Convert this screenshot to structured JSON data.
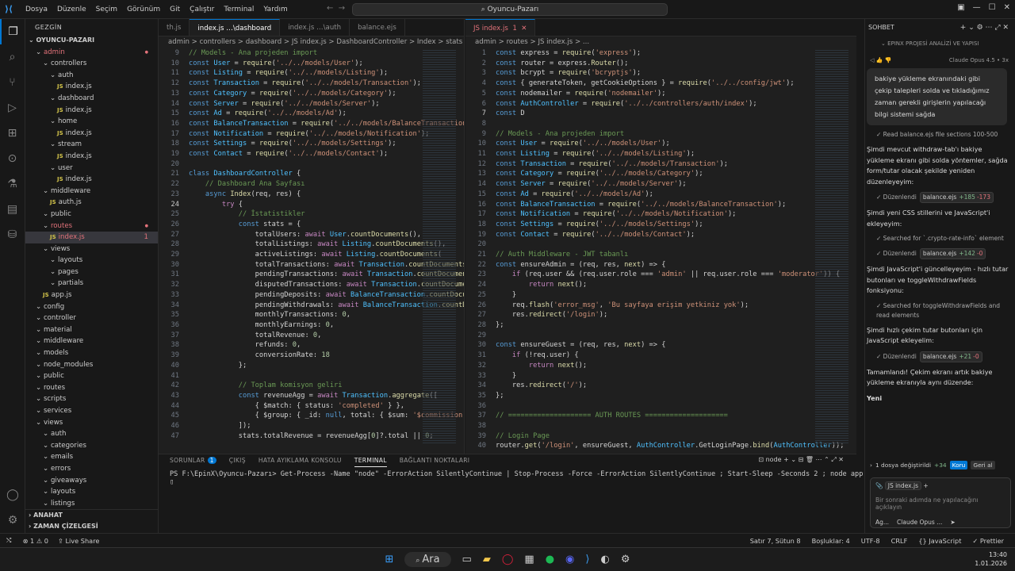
{
  "menu": [
    "Dosya",
    "Düzenle",
    "Seçim",
    "Görünüm",
    "Git",
    "Çalıştır",
    "Terminal",
    "Yardım"
  ],
  "search": "Oyuncu-Pazarı",
  "sidebar": {
    "title": "GEZGİN",
    "root": "OYUNCU-PAZARI",
    "tree": [
      {
        "t": "admin",
        "d": 1,
        "f": 1,
        "m": 1
      },
      {
        "t": "controllers",
        "d": 2,
        "f": 1
      },
      {
        "t": "auth",
        "d": 3,
        "f": 1
      },
      {
        "t": "index.js",
        "d": 4,
        "js": 1
      },
      {
        "t": "dashboard",
        "d": 3,
        "f": 1
      },
      {
        "t": "index.js",
        "d": 4,
        "js": 1
      },
      {
        "t": "home",
        "d": 3,
        "f": 1
      },
      {
        "t": "index.js",
        "d": 4,
        "js": 1
      },
      {
        "t": "stream",
        "d": 3,
        "f": 1
      },
      {
        "t": "index.js",
        "d": 4,
        "js": 1
      },
      {
        "t": "user",
        "d": 3,
        "f": 1
      },
      {
        "t": "index.js",
        "d": 4,
        "js": 1
      },
      {
        "t": "middleware",
        "d": 2,
        "f": 1
      },
      {
        "t": "auth.js",
        "d": 3,
        "js": 1
      },
      {
        "t": "public",
        "d": 2,
        "f": 1
      },
      {
        "t": "routes",
        "d": 2,
        "f": 1,
        "m": 1
      },
      {
        "t": "index.js",
        "d": 3,
        "js": 1,
        "m": 1,
        "sel": 1,
        "badge": "1"
      },
      {
        "t": "views",
        "d": 2,
        "f": 1
      },
      {
        "t": "layouts",
        "d": 3,
        "f": 1
      },
      {
        "t": "pages",
        "d": 3,
        "f": 1
      },
      {
        "t": "partials",
        "d": 3,
        "f": 1
      },
      {
        "t": "app.js",
        "d": 2,
        "js": 1
      },
      {
        "t": "config",
        "d": 1,
        "f": 1
      },
      {
        "t": "controller",
        "d": 1,
        "f": 1
      },
      {
        "t": "material",
        "d": 1,
        "f": 1
      },
      {
        "t": "middleware",
        "d": 1,
        "f": 1
      },
      {
        "t": "models",
        "d": 1,
        "f": 1
      },
      {
        "t": "node_modules",
        "d": 1,
        "f": 1
      },
      {
        "t": "public",
        "d": 1,
        "f": 1
      },
      {
        "t": "routes",
        "d": 1,
        "f": 1
      },
      {
        "t": "scripts",
        "d": 1,
        "f": 1
      },
      {
        "t": "services",
        "d": 1,
        "f": 1
      },
      {
        "t": "views",
        "d": 1,
        "f": 1
      },
      {
        "t": "auth",
        "d": 2,
        "f": 1
      },
      {
        "t": "categories",
        "d": 2,
        "f": 1
      },
      {
        "t": "emails",
        "d": 2,
        "f": 1
      },
      {
        "t": "errors",
        "d": 2,
        "f": 1
      },
      {
        "t": "giveaways",
        "d": 2,
        "f": 1
      },
      {
        "t": "layouts",
        "d": 2,
        "f": 1
      },
      {
        "t": "listings",
        "d": 2,
        "f": 1
      }
    ],
    "outline": "ANAHAT",
    "timeline": "ZAMAN ÇİZELGESİ"
  },
  "editor1": {
    "tabs": [
      "th.js",
      "index.js …\\dashboard",
      "index.js …\\auth",
      "balance.ejs"
    ],
    "breadcrumb": "admin > controllers > dashboard > JS index.js > DashboardController > Index > stats",
    "lines": [
      "// Models - Ana projeden import",
      "const User = require('../../models/User');",
      "const Listing = require('../../models/Listing');",
      "const Transaction = require('../../models/Transaction');",
      "const Category = require('../../models/Category');",
      "const Server = require('../../models/Server');",
      "const Ad = require('../../models/Ad');",
      "const BalanceTransaction = require('../../models/BalanceTransaction');",
      "const Notification = require('../../models/Notification');",
      "const Settings = require('../../models/Settings');",
      "const Contact = require('../../models/Contact');",
      "",
      "class DashboardController {",
      "    // Dashboard Ana Sayfası",
      "    async Index(req, res) {",
      "        try {",
      "            // İstatistikler",
      "            const stats = {",
      "                totalUsers: await User.countDocuments(),",
      "                totalListings: await Listing.countDocuments(),",
      "                activeListings: await Listing.countDocuments(",
      "                totalTransactions: await Transaction.countDocuments(",
      "                pendingTransactions: await Transaction.countDocuments(",
      "                disputedTransactions: await Transaction.countDocuments(",
      "                pendingDeposits: await BalanceTransaction.countDocuments(",
      "                pendingWithdrawals: await BalanceTransaction.countDocuments(",
      "                monthlyTransactions: 0,",
      "                monthlyEarnings: 0,",
      "                totalRevenue: 0,",
      "                refunds: 0,",
      "                conversionRate: 18",
      "            };",
      "",
      "            // Toplam komisyon geliri",
      "            const revenueAgg = await Transaction.aggregate([",
      "                { $match: { status: 'completed' } },",
      "                { $group: { _id: null, total: { $sum: '$commission' } } }",
      "            ]);",
      "            stats.totalRevenue = revenueAgg[0]?.total || 0;"
    ],
    "start": 9,
    "cur": 24
  },
  "editor2": {
    "tab": "index.js",
    "tabBadge": "1",
    "breadcrumb": "admin > routes > JS index.js > ...",
    "lines": [
      "const express = require('express');",
      "const router = express.Router();",
      "const bcrypt = require('bcryptjs');",
      "const { generateToken, getCookieOptions } = require('../../config/jwt');",
      "const nodemailer = require('nodemailer');",
      "const AuthController = require('../../controllers/auth/index');",
      "const D",
      "",
      "// Models - Ana projeden import",
      "const User = require('../../models/User');",
      "const Listing = require('../../models/Listing');",
      "const Transaction = require('../../models/Transaction');",
      "const Category = require('../../models/Category');",
      "const Server = require('../../models/Server');",
      "const Ad = require('../../models/Ad');",
      "const BalanceTransaction = require('../../models/BalanceTransaction');",
      "const Notification = require('../../models/Notification');",
      "const Settings = require('../../models/Settings');",
      "const Contact = require('../../models/Contact');",
      "",
      "// Auth Middleware - JWT tabanlı",
      "const ensureAdmin = (req, res, next) => {",
      "    if (req.user && (req.user.role === 'admin' || req.user.role === 'moderator')) {",
      "        return next();",
      "    }",
      "    req.flash('error_msg', 'Bu sayfaya erişim yetkiniz yok');",
      "    res.redirect('/login');",
      "};",
      "",
      "const ensureGuest = (req, res, next) => {",
      "    if (!req.user) {",
      "        return next();",
      "    }",
      "    res.redirect('/');",
      "};",
      "",
      "// ==================== AUTH ROUTES ====================",
      "",
      "// Login Page",
      "router.get('/login', ensureGuest, AuthController.GetLoginPage.bind(AuthController));"
    ],
    "start": 1,
    "cur": 7
  },
  "panel": {
    "tabs": [
      "SORUNLAR",
      "ÇIKIŞ",
      "HATA AYIKLAMA KONSOLU",
      "TERMINAL",
      "BAĞLANTI NOKTALARI"
    ],
    "problems": "1",
    "shell": "node",
    "cmd": "PS F:\\EpinX\\Oyuncu-Pazarı> Get-Process -Name \"node\" -ErrorAction SilentlyContinue | Stop-Process -Force -ErrorAction SilentlyContinue ; Start-Sleep -Seconds 2 ; node app.js"
  },
  "chat": {
    "title": "SOHBET",
    "session": "EPINX PROJESİ ANALİZİ VE YAPISI",
    "model": "Claude Opus 4.5 • 3x",
    "user_msg": "bakiye yükleme ekranındaki gibi çekip talepleri solda ve tıkladığımız zaman gerekli girişlerin yapılacağı bilgi sistemi sağda",
    "items": [
      {
        "k": "s",
        "t": "Read balance.ejs file sections 100-500"
      },
      {
        "k": "p",
        "t": "Şimdi mevcut withdraw-tab'ı bakiye yükleme ekranı gibi solda yöntemler, sağda form/tutar olacak şekilde yeniden düzenleyeyim:"
      },
      {
        "k": "e",
        "t": "Düzenlendi",
        "f": "balance.ejs",
        "a": "+185",
        "r": "-173"
      },
      {
        "k": "p",
        "t": "Şimdi yeni CSS stillerini ve JavaScript'i ekleyeyim:"
      },
      {
        "k": "s",
        "t": "Searched for `.crypto-rate-info` element"
      },
      {
        "k": "e",
        "t": "Düzenlendi",
        "f": "balance.ejs",
        "a": "+142",
        "r": "-0"
      },
      {
        "k": "p",
        "t": "Şimdi JavaScript'i güncelleyeyim - hızlı tutar butonları ve toggleWithdrawFields fonksiyonu:"
      },
      {
        "k": "s",
        "t": "Searched for toggleWithdrawFields and read elements"
      },
      {
        "k": "p",
        "t": "Şimdi hızlı çekim tutar butonları için JavaScript ekleyelim:"
      },
      {
        "k": "e",
        "t": "Düzenlendi",
        "f": "balance.ejs",
        "a": "+21",
        "r": "-0"
      },
      {
        "k": "p",
        "t": "Tamamlandı! Çekim ekranı artık bakiye yükleme ekranıyla aynı düzende:"
      },
      {
        "k": "b",
        "t": "Yeni"
      }
    ],
    "changes": "1 dosya değiştirildi",
    "changes_add": "+34",
    "keep": "Koru",
    "undo": "Geri al",
    "ctx_file": "index.js",
    "placeholder": "Bir sonraki adımda ne yapılacağını açıklayın",
    "agent": "Ag...",
    "model_sel": "Claude Opus ..."
  },
  "status": {
    "left": "⊗ 1 ⚠ 0",
    "live": "Live Share",
    "pos": "Satır 7, Sütun 8",
    "spaces": "Boşluklar: 4",
    "enc": "UTF-8",
    "eol": "CRLF",
    "lang": "JavaScript",
    "fmt": "Prettier"
  },
  "taskbar": {
    "search": "Ara",
    "time": "13:40",
    "date": "1.01.2026"
  }
}
